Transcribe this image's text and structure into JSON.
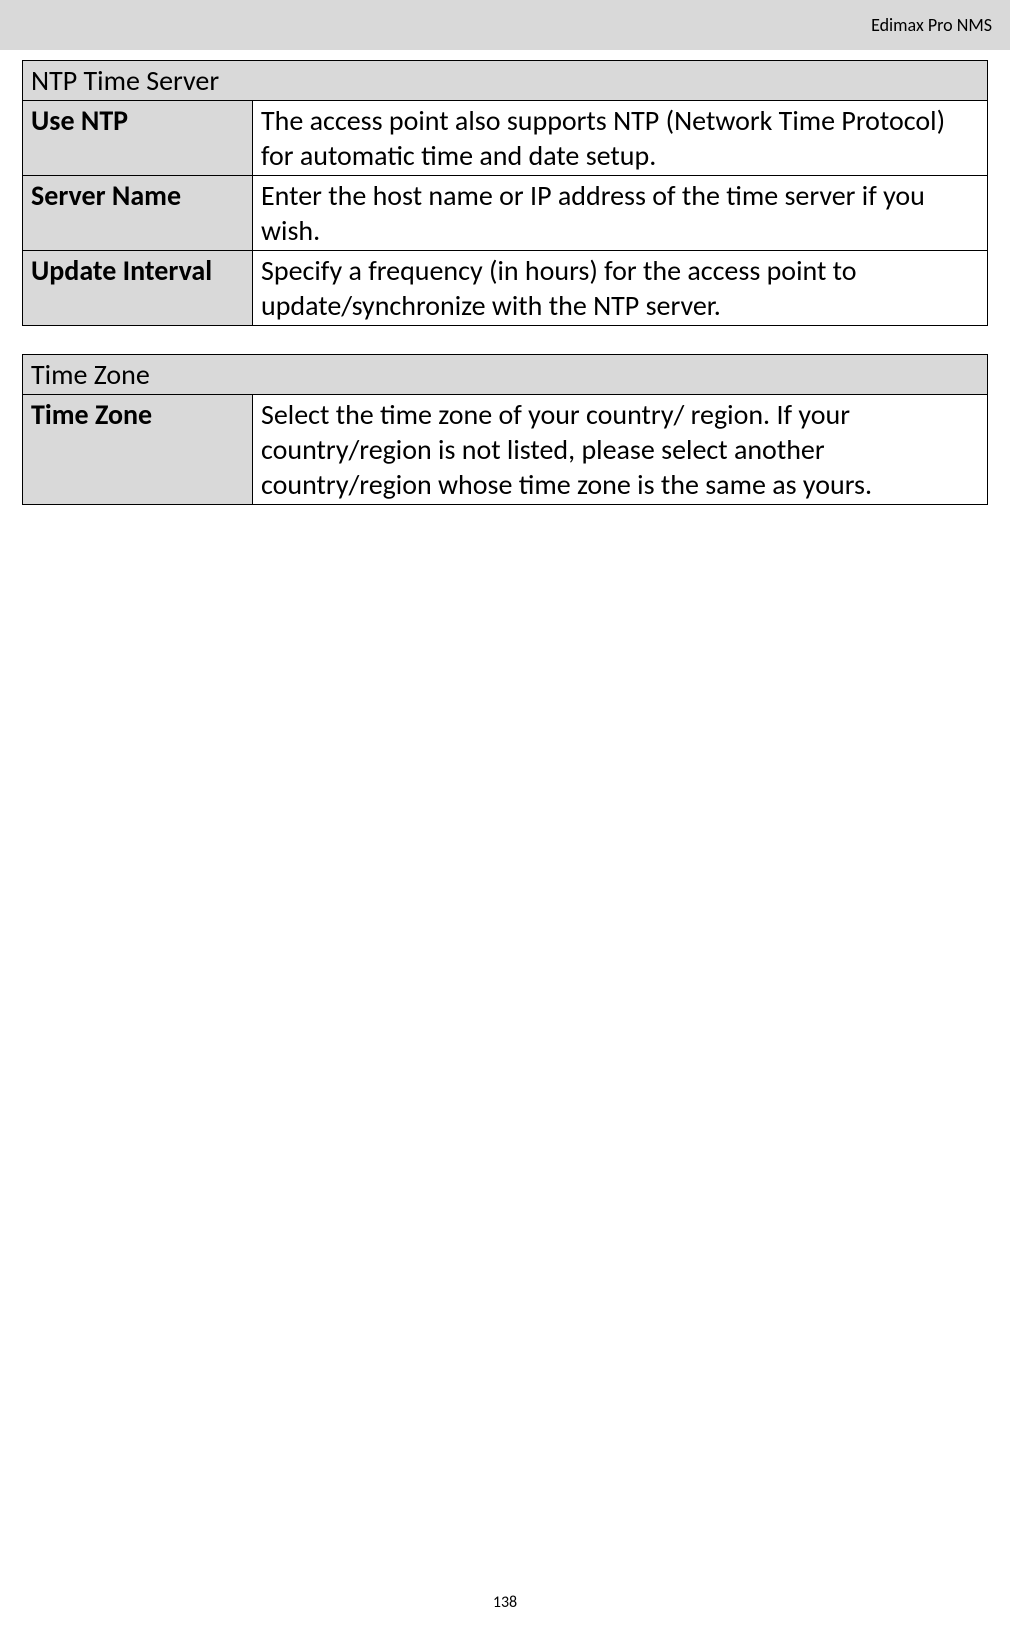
{
  "header": {
    "title": "Edimax Pro NMS"
  },
  "tables": {
    "ntp": {
      "header": "NTP Time Server",
      "rows": [
        {
          "label": "Use NTP",
          "value": "The access point also supports NTP (Network Time Protocol) for automatic time and date setup."
        },
        {
          "label": "Server Name",
          "value": "Enter the host name or IP address of the time server if you wish."
        },
        {
          "label": "Update Interval",
          "value": "Specify a frequency (in hours) for the access point to update/synchronize with the NTP server."
        }
      ]
    },
    "tz": {
      "header": "Time Zone",
      "rows": [
        {
          "label": "Time Zone",
          "value": "Select the time zone of your country/ region. If your country/region is not listed, please select another country/region whose time zone is the same as yours."
        }
      ]
    }
  },
  "page_number": "138"
}
